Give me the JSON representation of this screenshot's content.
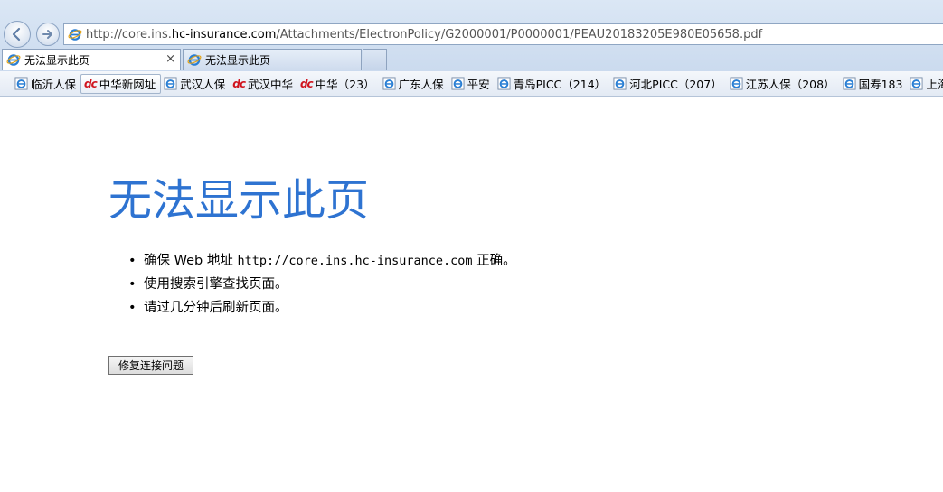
{
  "browser": {
    "address": {
      "url_prefix": "http://core.ins.",
      "url_domain": "hc-insurance.com",
      "url_path": "/Attachments/ElectronPolicy/G2000001/P0000001/PEAU20183205E980E05658.pdf"
    },
    "tabs": [
      {
        "label": "无法显示此页",
        "close": "×"
      },
      {
        "label": "无法显示此页"
      }
    ],
    "favorites": [
      {
        "label": "临沂人保",
        "icon": "ie-icon"
      },
      {
        "label": "中华新网址",
        "icon": "dc-icon"
      },
      {
        "label": "武汉人保",
        "icon": "ie-icon"
      },
      {
        "label": "武汉中华",
        "icon": "dc-icon"
      },
      {
        "label": "中华（23）",
        "icon": "dc-icon"
      },
      {
        "label": "广东人保",
        "icon": "ie-icon"
      },
      {
        "label": "平安",
        "icon": "ie-icon"
      },
      {
        "label": "青岛PICC（214）",
        "icon": "ie-icon"
      },
      {
        "label": "河北PICC（207）",
        "icon": "ie-icon"
      },
      {
        "label": "江苏人保（208）",
        "icon": "ie-icon"
      },
      {
        "label": "国寿183",
        "icon": "ie-icon"
      },
      {
        "label": "上海",
        "icon": "ie-icon"
      }
    ],
    "dc_glyph": "dc"
  },
  "page": {
    "title": "无法显示此页",
    "bullet_glyph": "•",
    "bullets": {
      "b1_pre": "确保 Web 地址 ",
      "b1_url": "http://core.ins.hc-insurance.com",
      "b1_post": " 正确。",
      "b2": "使用搜索引擎查找页面。",
      "b3": "请过几分钟后刷新页面。"
    },
    "fix_button": "修复连接问题"
  },
  "colors": {
    "title_blue": "#2e73d1",
    "chrome_blue": "#c5d6ec"
  }
}
